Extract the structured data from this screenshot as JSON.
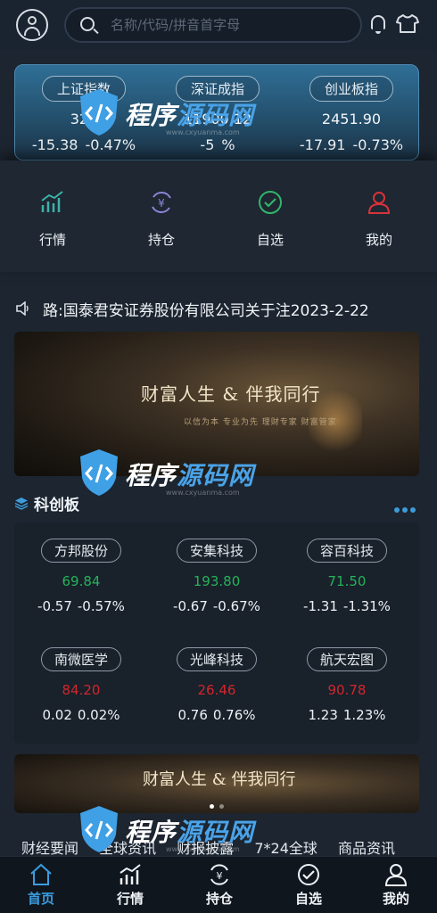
{
  "header": {
    "search_placeholder": "名称/代码/拼音首字母",
    "icons": [
      "avatar-icon",
      "search-icon",
      "bell-icon",
      "shirt-icon"
    ]
  },
  "indices": [
    {
      "name": "上证指数",
      "value": "329",
      "change": "-15.38",
      "percent": "-0.47%"
    },
    {
      "name": "深证成指",
      "value": "11900.12",
      "change": "-5",
      "percent": "%"
    },
    {
      "name": "创业板指",
      "value": "2451.90",
      "change": "-17.91",
      "percent": "-0.73%"
    }
  ],
  "quick_nav": [
    {
      "label": "行情",
      "icon": "chart-icon"
    },
    {
      "label": "持仓",
      "icon": "yuan-cycle-icon"
    },
    {
      "label": "自选",
      "icon": "check-circle-icon"
    },
    {
      "label": "我的",
      "icon": "user-icon"
    }
  ],
  "notice": {
    "text": "路:国泰君安证券股份有限公司关于注2023-2-22",
    "icon": "speaker-icon"
  },
  "banner": {
    "slogan": "财富人生 & 伴我同行",
    "sub": "以信为本 专业为先 理财专家 财富管家"
  },
  "section": {
    "title": "科创板",
    "icon": "layers-icon"
  },
  "stocks": [
    {
      "name": "方邦股份",
      "price": "69.84",
      "change": "-0.57",
      "percent": "-0.57%",
      "dir": "up"
    },
    {
      "name": "安集科技",
      "price": "193.80",
      "change": "-0.67",
      "percent": "-0.67%",
      "dir": "up"
    },
    {
      "name": "容百科技",
      "price": "71.50",
      "change": "-1.31",
      "percent": "-1.31%",
      "dir": "up"
    },
    {
      "name": "南微医学",
      "price": "84.20",
      "change": "0.02",
      "percent": "0.02%",
      "dir": "down"
    },
    {
      "name": "光峰科技",
      "price": "26.46",
      "change": "0.76",
      "percent": "0.76%",
      "dir": "down"
    },
    {
      "name": "航天宏图",
      "price": "90.78",
      "change": "1.23",
      "percent": "1.23%",
      "dir": "down"
    }
  ],
  "banner2": {
    "slogan": "财富人生 & 伴我同行"
  },
  "news_tabs": [
    "财经要闻",
    "全球资讯",
    "财报披露",
    "7*24全球",
    "商品资讯"
  ],
  "tabbar": [
    {
      "label": "首页",
      "icon": "home-icon",
      "active": true
    },
    {
      "label": "行情",
      "icon": "chart-icon",
      "active": false
    },
    {
      "label": "持仓",
      "icon": "yuan-cycle-icon",
      "active": false
    },
    {
      "label": "自选",
      "icon": "check-circle-icon",
      "active": false
    },
    {
      "label": "我的",
      "icon": "user-icon",
      "active": false
    }
  ],
  "watermark": {
    "brand_a": "程序",
    "brand_b": "源码网",
    "url": "www.cxyuanma.com"
  },
  "colors": {
    "up": "#25b358",
    "down": "#d2262b",
    "accent": "#3a9de0",
    "background": "#1c2530"
  }
}
